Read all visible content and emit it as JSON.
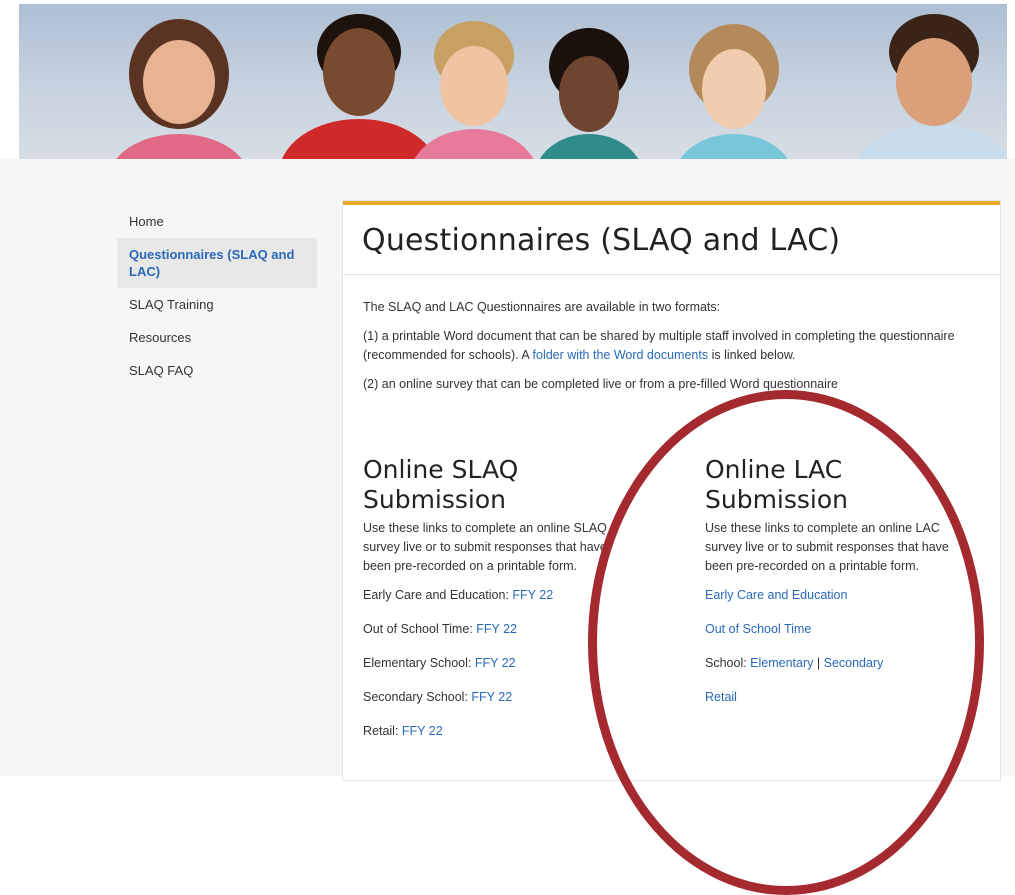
{
  "sidebar": {
    "items": [
      {
        "label": "Home"
      },
      {
        "label": "Questionnaires (SLAQ and LAC)"
      },
      {
        "label": "SLAQ Training"
      },
      {
        "label": "Resources"
      },
      {
        "label": "SLAQ FAQ"
      }
    ]
  },
  "main": {
    "title": "Questionnaires (SLAQ and LAC)",
    "intro1": "The SLAQ and LAC Questionnaires are available in two formats:",
    "intro2_pre": "(1) a printable Word document that can be shared by multiple staff involved in completing the questionnaire (recommended for schools). A ",
    "intro2_link": "folder with the Word documents",
    "intro2_post": " is linked below.",
    "intro3": "(2) an online survey that can be completed live or from a pre-filled Word questionnaire"
  },
  "slaq": {
    "heading": "Online SLAQ Submission",
    "description": "Use these links to complete an online SLAQ survey live or to submit responses that have been pre-recorded on a printable form.",
    "rows": [
      {
        "label": "Early Care and Education: ",
        "link": "FFY 22"
      },
      {
        "label": "Out of School Time: ",
        "link": "FFY 22"
      },
      {
        "label": "Elementary School: ",
        "link": "FFY 22"
      },
      {
        "label": "Secondary School: ",
        "link": "FFY 22"
      },
      {
        "label": "Retail: ",
        "link": "FFY 22"
      }
    ]
  },
  "lac": {
    "heading": "Online LAC Submission",
    "description": "Use these links to complete an online LAC survey live or to submit responses that have been pre-recorded on a printable form.",
    "early_care": "Early Care and Education",
    "out_of_school": "Out of School Time",
    "school_label": "School: ",
    "elementary": "Elementary",
    "separator": " | ",
    "secondary": "Secondary",
    "retail": "Retail"
  },
  "colors": {
    "accent": "#e6a92a",
    "link": "#2a69b8",
    "annotation": "#a42a2f"
  }
}
